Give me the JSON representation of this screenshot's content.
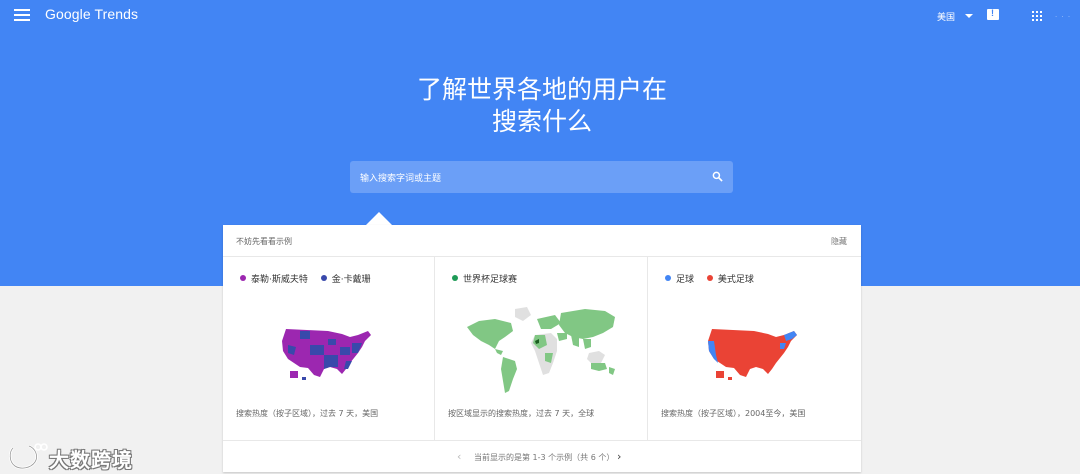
{
  "header": {
    "brand": "Google Trends",
    "region": "美国",
    "account_placeholder": "· · ·"
  },
  "hero": {
    "title_line1": "了解世界各地的用户在",
    "title_line2": "搜索什么",
    "search_placeholder": "输入搜索字词或主题"
  },
  "examples": {
    "heading": "不妨先看看示例",
    "hide_label": "隐藏",
    "cards": [
      {
        "legend": [
          {
            "label": "泰勒·斯威夫特",
            "color": "#9c27b0"
          },
          {
            "label": "金·卡戴珊",
            "color": "#3949ab"
          }
        ],
        "caption": "搜索热度（按子区域），过去 7 天，美国"
      },
      {
        "legend": [
          {
            "label": "世界杯足球赛",
            "color": "#1e9b57"
          }
        ],
        "caption": "按区域显示的搜索热度，过去 7 天，全球"
      },
      {
        "legend": [
          {
            "label": "足球",
            "color": "#4285f4"
          },
          {
            "label": "美式足球",
            "color": "#ea4335"
          }
        ],
        "caption": "搜索热度（按子区域），2004至今，美国"
      }
    ],
    "pagination": {
      "prev": "‹",
      "text": "当前显示的是第 1-3 个示例（共 6 个）",
      "next": "›"
    }
  },
  "watermark": {
    "text": "大数跨境"
  },
  "colors": {
    "brand_blue": "#4285f4",
    "search_bg": "#6b9ff7",
    "map_grey": "#e0e0e0"
  }
}
